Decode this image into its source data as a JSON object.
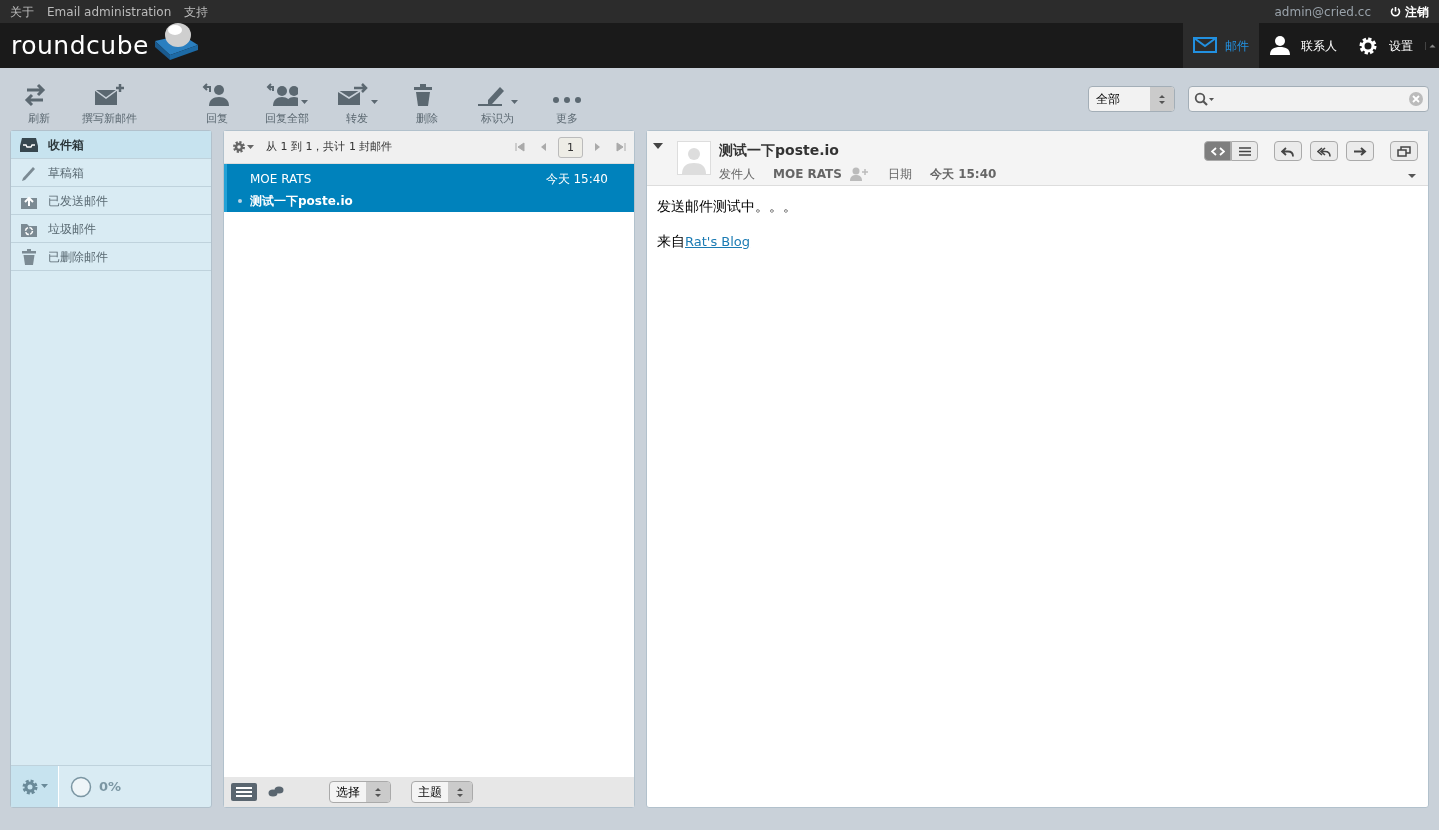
{
  "top_bar": {
    "links": [
      "关于",
      "Email administration",
      "支持"
    ],
    "user": "admin@cried.cc",
    "logout": "注销"
  },
  "header": {
    "logo": "roundcube",
    "tasks": [
      {
        "kind": "mail",
        "label": "邮件",
        "selected": true
      },
      {
        "kind": "contacts",
        "label": "联系人",
        "selected": false
      },
      {
        "kind": "settings",
        "label": "设置",
        "selected": false
      }
    ]
  },
  "toolbar": [
    {
      "kind": "refresh",
      "label": "刷新",
      "menu": false
    },
    {
      "kind": "compose",
      "label": "撰写新邮件",
      "menu": false
    },
    {
      "kind": "reply",
      "label": "回复",
      "menu": false
    },
    {
      "kind": "reply_all",
      "label": "回复全部",
      "menu": true
    },
    {
      "kind": "forward",
      "label": "转发",
      "menu": true
    },
    {
      "kind": "delete",
      "label": "删除",
      "menu": false
    },
    {
      "kind": "mark",
      "label": "标识为",
      "menu": true
    },
    {
      "kind": "more",
      "label": "更多",
      "menu": false
    }
  ],
  "search": {
    "filter": "全部"
  },
  "folders": [
    {
      "kind": "inbox",
      "label": "收件箱",
      "selected": true
    },
    {
      "kind": "drafts",
      "label": "草稿箱",
      "selected": false
    },
    {
      "kind": "sent",
      "label": "已发送邮件",
      "selected": false
    },
    {
      "kind": "junk",
      "label": "垃圾邮件",
      "selected": false
    },
    {
      "kind": "trash",
      "label": "已删除邮件",
      "selected": false
    }
  ],
  "quota": "0%",
  "message_list": {
    "count": "从 1 到 1，共计 1 封邮件",
    "page": "1",
    "messages": [
      {
        "from": "MOE RATS",
        "date": "今天 15:40",
        "subject": "测试一下poste.io",
        "selected": true
      }
    ],
    "modes": [
      {
        "kind": "list",
        "selected": true
      },
      {
        "kind": "threads",
        "selected": false
      }
    ],
    "select": "选择",
    "sort": "主题"
  },
  "preview": {
    "subject": "测试一下poste.io",
    "from_label": "发件人",
    "from": "MOE RATS",
    "date_label": "日期",
    "date": "今天 15:40",
    "view_modes": [
      {
        "kind": "html",
        "selected": true
      },
      {
        "kind": "plain",
        "selected": false
      }
    ],
    "body": [
      {
        "text": "发送邮件测试中。。。"
      },
      {
        "text": "来自",
        "link": "Rat's Blog"
      }
    ]
  }
}
